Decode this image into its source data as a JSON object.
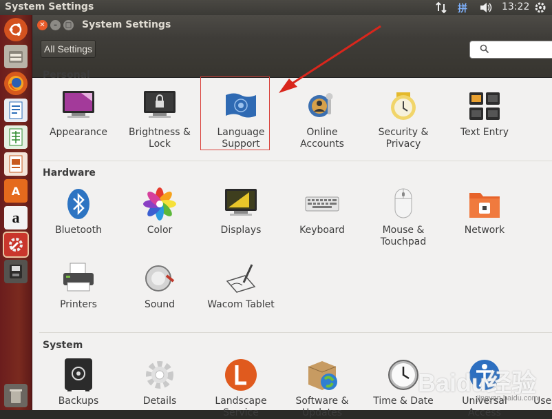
{
  "top_panel": {
    "title": "System Settings",
    "time": "13:22",
    "indicators": [
      "network-arrows-icon",
      "keyboard-input-icon",
      "volume-icon"
    ],
    "input_method": "拼"
  },
  "launcher": {
    "items": [
      {
        "name": "dash-home",
        "icon": "ubuntu-logo-icon"
      },
      {
        "name": "files",
        "icon": "file-manager-icon"
      },
      {
        "name": "firefox",
        "icon": "firefox-icon"
      },
      {
        "name": "libreoffice-writer",
        "icon": "writer-icon"
      },
      {
        "name": "libreoffice-calc",
        "icon": "calc-icon"
      },
      {
        "name": "libreoffice-impress",
        "icon": "impress-icon"
      },
      {
        "name": "software-center",
        "icon": "software-center-icon"
      },
      {
        "name": "amazon",
        "icon": "amazon-icon"
      },
      {
        "name": "system-settings",
        "icon": "system-settings-icon"
      },
      {
        "name": "drive",
        "icon": "drive-icon"
      },
      {
        "name": "trash",
        "icon": "trash-icon"
      }
    ],
    "amazon_letter": "a",
    "software_letter": "A"
  },
  "window": {
    "title": "System Settings",
    "toolbar": {
      "all_settings_label": "All Settings",
      "search_value": ""
    }
  },
  "sections": [
    {
      "title": "Personal",
      "items": [
        {
          "label": "Appearance",
          "icon": "appearance-icon"
        },
        {
          "label": "Brightness &\nLock",
          "icon": "brightness-lock-icon"
        },
        {
          "label": "Language\nSupport",
          "icon": "language-support-icon",
          "highlighted": true
        },
        {
          "label": "Online\nAccounts",
          "icon": "online-accounts-icon"
        },
        {
          "label": "Security &\nPrivacy",
          "icon": "security-privacy-icon"
        },
        {
          "label": "Text Entry",
          "icon": "text-entry-icon"
        }
      ]
    },
    {
      "title": "Hardware",
      "items": [
        {
          "label": "Bluetooth",
          "icon": "bluetooth-icon"
        },
        {
          "label": "Color",
          "icon": "color-icon"
        },
        {
          "label": "Displays",
          "icon": "displays-icon"
        },
        {
          "label": "Keyboard",
          "icon": "keyboard-icon"
        },
        {
          "label": "Mouse &\nTouchpad",
          "icon": "mouse-touchpad-icon"
        },
        {
          "label": "Network",
          "icon": "network-icon"
        },
        {
          "label": "Printers",
          "icon": "printers-icon"
        },
        {
          "label": "Sound",
          "icon": "sound-icon"
        },
        {
          "label": "Wacom Tablet",
          "icon": "wacom-tablet-icon"
        }
      ]
    },
    {
      "title": "System",
      "items": [
        {
          "label": "Backups",
          "icon": "backups-icon"
        },
        {
          "label": "Details",
          "icon": "details-icon"
        },
        {
          "label": "Landscape\nService",
          "icon": "landscape-service-icon"
        },
        {
          "label": "Software &\nUpdates",
          "icon": "software-updates-icon"
        },
        {
          "label": "Time & Date",
          "icon": "time-date-icon"
        },
        {
          "label": "Universal\nAccess",
          "icon": "universal-access-icon"
        },
        {
          "label": "Use",
          "icon": "user-accounts-icon"
        }
      ]
    }
  ],
  "annotation": {
    "highlight_color": "#d9403a",
    "arrow_color": "#d9261c"
  },
  "watermark": {
    "text": "Baidu经验",
    "url": "jingyan.baidu.com"
  },
  "colors": {
    "launcher": "#7a2a1f",
    "panel": "#3f3d39",
    "content": "#f2f1f0",
    "accent": "#dd4814"
  }
}
